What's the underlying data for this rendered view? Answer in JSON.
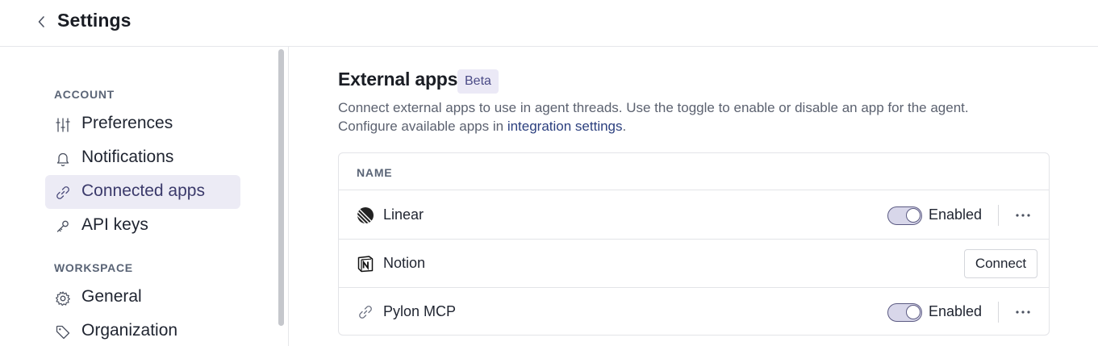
{
  "header": {
    "title": "Settings",
    "back_icon": "chevron-left-icon"
  },
  "sidebar": {
    "sections": [
      {
        "label": "ACCOUNT",
        "items": [
          {
            "label": "Preferences",
            "icon": "sliders-icon",
            "active": false
          },
          {
            "label": "Notifications",
            "icon": "bell-icon",
            "active": false
          },
          {
            "label": "Connected apps",
            "icon": "link-icon",
            "active": true
          },
          {
            "label": "API keys",
            "icon": "key-icon",
            "active": false
          }
        ]
      },
      {
        "label": "WORKSPACE",
        "items": [
          {
            "label": "General",
            "icon": "gear-icon",
            "active": false
          },
          {
            "label": "Organization",
            "icon": "tag-icon",
            "active": false
          }
        ]
      }
    ]
  },
  "main": {
    "title": "External apps",
    "badge": "Beta",
    "description": {
      "line1": "Connect external apps to use in agent threads. Use the toggle to enable or disable an app for the agent.",
      "line2_prefix": "Configure available apps in ",
      "line2_link": "integration settings",
      "line2_suffix": "."
    },
    "table": {
      "column_header": "NAME",
      "rows": [
        {
          "name": "Linear",
          "icon": "linear-logo-icon",
          "status": "Enabled",
          "enabled": true
        },
        {
          "name": "Notion",
          "icon": "notion-logo-icon",
          "action": "Connect"
        },
        {
          "name": "Pylon MCP",
          "icon": "link-icon",
          "status": "Enabled",
          "enabled": true
        }
      ]
    }
  },
  "colors": {
    "accent": "#5b5a82",
    "active_nav_bg": "#ecebf5",
    "badge_bg": "#ebe9f6",
    "link": "#2b3f7e"
  }
}
